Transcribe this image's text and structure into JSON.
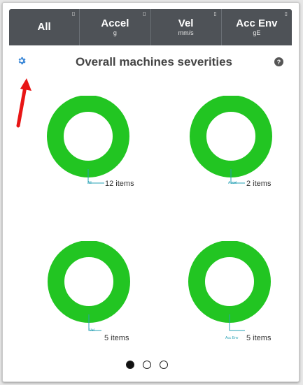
{
  "tabs": [
    {
      "label": "All",
      "unit": ""
    },
    {
      "label": "Accel",
      "unit": "g"
    },
    {
      "label": "Vel",
      "unit": "mm/s"
    },
    {
      "label": "Acc Env",
      "unit": "gE"
    }
  ],
  "title": "Overall machines severities",
  "help_glyph": "?",
  "icons": {
    "settings": "gear-icon",
    "help": "help-icon",
    "annotation": "red-arrow-icon"
  },
  "donuts": [
    {
      "mini_label": "All",
      "items_text": "12 items"
    },
    {
      "mini_label": "Accel",
      "items_text": "2 items"
    },
    {
      "mini_label": "Vel",
      "items_text": "5 items"
    },
    {
      "mini_label": "Acc Env",
      "items_text": "5 items"
    }
  ],
  "colors": {
    "ring": "#22c522",
    "leader": "#26a0b4",
    "header": "#4e5257",
    "arrow": "#e81515",
    "gear": "#3f8ad8"
  },
  "pagination": {
    "pages": 3,
    "active": 1
  }
}
